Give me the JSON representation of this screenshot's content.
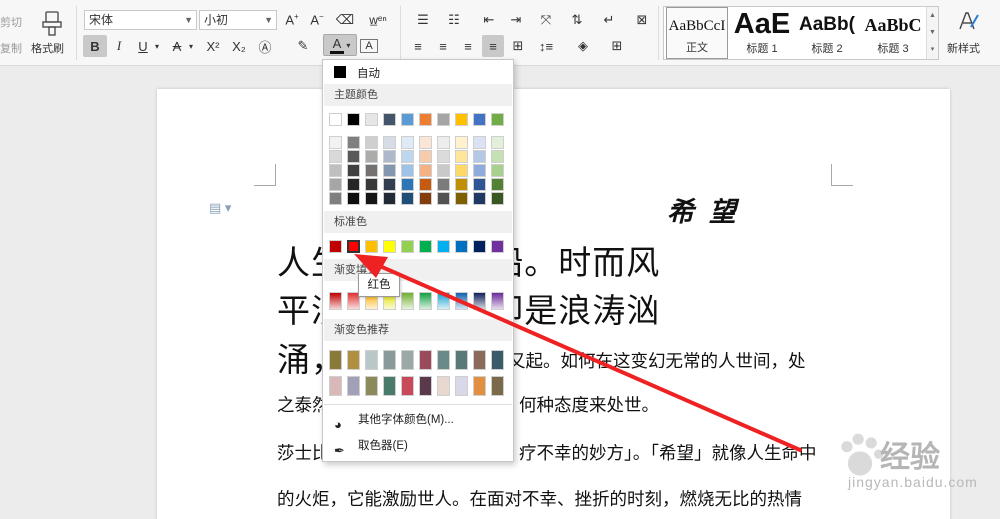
{
  "ribbon": {
    "cut": "剪切",
    "copy": "复制",
    "format_painter": "格式刷",
    "font_name": "宋体",
    "font_size": "小初",
    "bold": "B",
    "italic": "I",
    "underline": "U",
    "strikethrough": "A",
    "superscript": "X²",
    "subscript": "X₂",
    "styles": [
      {
        "preview": "AaBbCcI",
        "name": "正文"
      },
      {
        "preview": "AaE",
        "name": "标题 1"
      },
      {
        "preview": "AaBb(",
        "name": "标题 2"
      },
      {
        "preview": "AaBbC",
        "name": "标题 3"
      }
    ],
    "new_style": "新样式"
  },
  "color_menu": {
    "auto": "自动",
    "theme_colors_title": "主题颜色",
    "theme_top": [
      "#ffffff",
      "#000000",
      "#e7e6e6",
      "#44546a",
      "#5b9bd5",
      "#ed7d31",
      "#a5a5a5",
      "#ffc000",
      "#4472c4",
      "#70ad47"
    ],
    "theme_shades": [
      [
        "#f2f2f2",
        "#7f7f7f",
        "#d0cece",
        "#d6dce5",
        "#deebf7",
        "#fbe5d6",
        "#ededed",
        "#fff2cc",
        "#dae3f3",
        "#e2f0d9"
      ],
      [
        "#d9d9d9",
        "#595959",
        "#aeabab",
        "#adb9ca",
        "#bdd7ee",
        "#f8cbad",
        "#dbdbdb",
        "#ffe699",
        "#b4c7e7",
        "#c5e0b4"
      ],
      [
        "#bfbfbf",
        "#404040",
        "#767171",
        "#8497b0",
        "#9dc3e6",
        "#f4b183",
        "#c9c9c9",
        "#ffd966",
        "#8faadc",
        "#a9d18e"
      ],
      [
        "#a6a6a6",
        "#262626",
        "#3b3838",
        "#333f50",
        "#2e75b6",
        "#c55a11",
        "#7b7b7b",
        "#bf9000",
        "#2f5597",
        "#548235"
      ],
      [
        "#7f7f7f",
        "#0d0d0d",
        "#171616",
        "#222a35",
        "#1f4e79",
        "#843c0c",
        "#525252",
        "#7f6000",
        "#203864",
        "#385723"
      ]
    ],
    "standard_title": "标准色",
    "standard": [
      "#c00000",
      "#ff0000",
      "#ffc000",
      "#ffff00",
      "#92d050",
      "#00b050",
      "#00b0f0",
      "#0070c0",
      "#002060",
      "#7030a0"
    ],
    "gradient_title": "渐变填充",
    "gradient": [
      "#c00000",
      "#e03030",
      "#ffb000",
      "#e0e000",
      "#70b030",
      "#10a040",
      "#10a0d0",
      "#1060b0",
      "#10205a",
      "#6a2a9a"
    ],
    "gradient_rec_title": "渐变色推荐",
    "gradient_rec": [
      [
        "#8a7a3a",
        "#b09040",
        "#b8c8c8",
        "#8a9a9a",
        "#9aa8a8",
        "#9a4a5a",
        "#6a8a8a",
        "#5a7a7a",
        "#8a6a5a",
        "#3a5a6a"
      ],
      [
        "#d8b8b8",
        "#a0a0b8",
        "#8a8a5a",
        "#4a7a6a",
        "#c84a5a",
        "#5a3a4a",
        "#e8d8d0",
        "#d8d8e8",
        "#e09040",
        "#7a6a4a"
      ]
    ],
    "more_colors": "其他字体颜色(M)...",
    "picker": "取色器(E)",
    "tooltip": "红色"
  },
  "document": {
    "title": "希  望",
    "line1": "人生                  汪洋中行船。时而风",
    "line2": "平浪                  顺；时而却是浪涛汹",
    "line3_a": "涌，",
    "line3_b": "又起。如何在这变幻无常的人世间，处",
    "line4_a": "之泰然",
    "line4_b": "何种态度来处世。",
    "line5_a": "莎士比",
    "line5_b": "疗不幸的妙方」。「希望」就像人生命中",
    "line6": "的火炬，它能激励世人。在面对不幸、挫折的时刻，燃烧无比的热情"
  },
  "watermark": {
    "brand": "经验",
    "site": "jingyan.baidu.com"
  }
}
